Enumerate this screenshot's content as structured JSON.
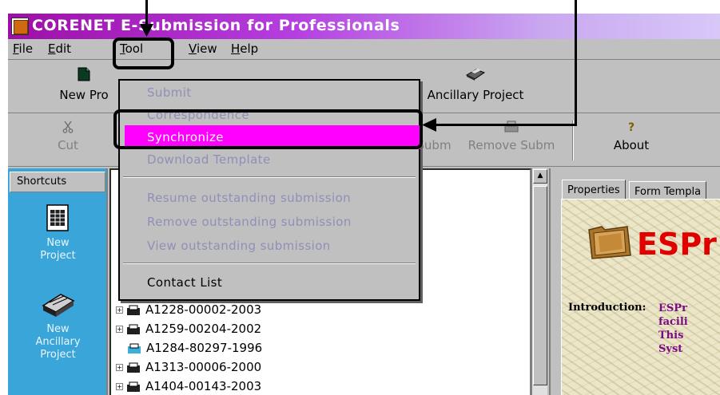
{
  "window": {
    "title": "CORENET E-Submission for Professionals"
  },
  "menubar": {
    "items": [
      "File",
      "Edit",
      "Tool",
      "View",
      "Help"
    ]
  },
  "toolbar1": {
    "buttons": [
      {
        "label": "New Pro",
        "icon": "new-project-icon"
      },
      {
        "label": "Ancillary Project",
        "icon": "ancillary-project-icon"
      }
    ]
  },
  "toolbar2": {
    "buttons": [
      {
        "label": "Cut",
        "icon": "cut-icon",
        "disabled": true
      },
      {
        "label": "Subm",
        "icon": "",
        "disabled": true
      },
      {
        "label": "Remove Subm",
        "icon": "remove-submission-icon",
        "disabled": true
      },
      {
        "label": "About",
        "icon": "about-icon",
        "disabled": false
      }
    ]
  },
  "tool_menu": {
    "items": [
      {
        "label": "Submit",
        "state": "disabled"
      },
      {
        "label": "Correspondence",
        "state": "disabled"
      },
      {
        "label": "Synchronize",
        "state": "highlighted"
      },
      {
        "label": "Download Template",
        "state": "disabled"
      },
      {
        "label": "Resume outstanding submission",
        "state": "disabled"
      },
      {
        "label": "Remove outstanding submission",
        "state": "disabled"
      },
      {
        "label": "View outstanding submission",
        "state": "disabled"
      },
      {
        "label": "Contact List",
        "state": "enabled"
      }
    ]
  },
  "shortcuts": {
    "header": "Shortcuts",
    "items": [
      {
        "label": "New Project",
        "icon": "new-project-icon"
      },
      {
        "label": "New Ancillary Project",
        "icon": "ancillary-project-icon"
      }
    ]
  },
  "tree": {
    "rows": [
      {
        "label": "A1228-00002-2003",
        "expandable": true
      },
      {
        "label": "A1259-00204-2002",
        "expandable": true
      },
      {
        "label": "A1284-80297-1996",
        "expandable": false
      },
      {
        "label": "A1313-00006-2000",
        "expandable": true
      },
      {
        "label": "A1404-00143-2003",
        "expandable": true
      }
    ]
  },
  "right_panel": {
    "tabs": [
      "Properties",
      "Form Templa"
    ],
    "active_tab": "Properties",
    "banner_title": "ESPr",
    "intro_label": "Introduction:",
    "intro_lines": [
      "ESPr",
      "facili",
      "This",
      "Syst"
    ]
  },
  "colors": {
    "menu_highlight": "#ff00ff",
    "shortcut_bar": "#3aa5d8",
    "banner_title": "#e00000",
    "intro_text": "#7a0a82"
  }
}
